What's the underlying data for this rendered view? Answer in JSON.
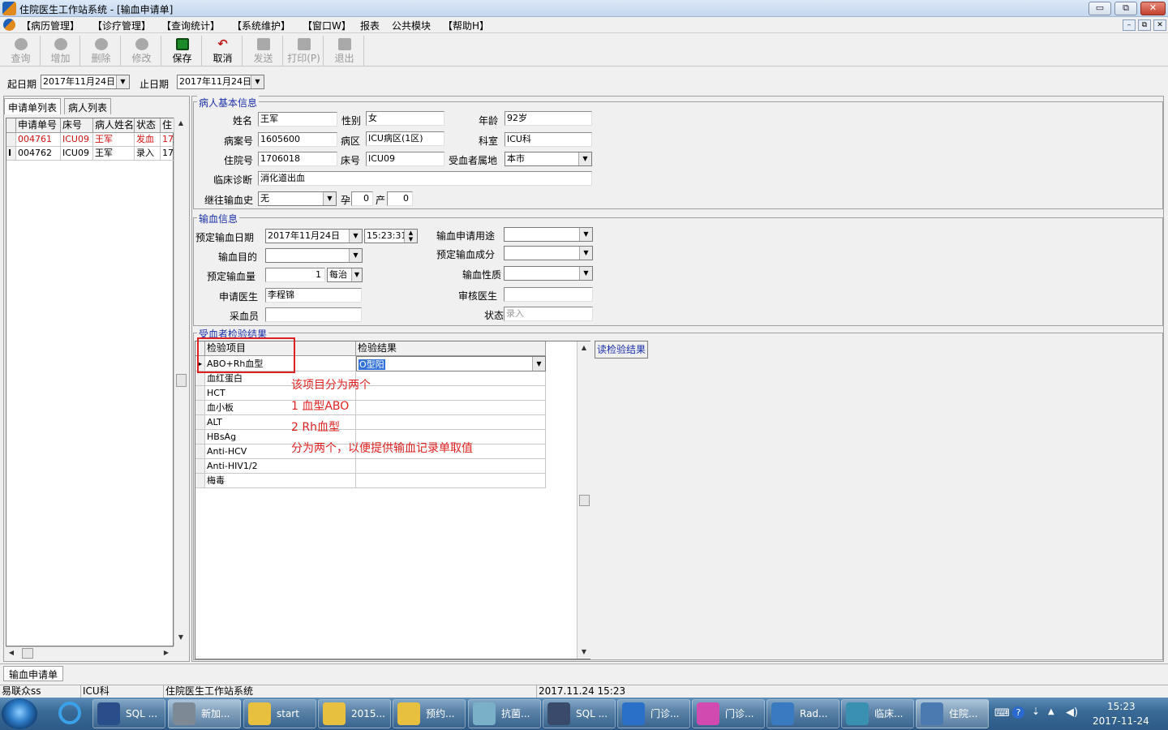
{
  "window": {
    "title": "住院医生工作站系统 - [输血申请单]",
    "min": "▭",
    "restore": "⧉",
    "close": "✕"
  },
  "menu": [
    "【病历管理】",
    "【诊疗管理】",
    "【查询统计】",
    "【系统维护】",
    "【窗口W】",
    "报表",
    "公共模块",
    "【帮助H】"
  ],
  "mdi": [
    "–",
    "⧉",
    "✕"
  ],
  "toolbar": [
    {
      "label": "查询",
      "enabled": false
    },
    {
      "label": "增加",
      "enabled": false
    },
    {
      "label": "删除",
      "enabled": false
    },
    {
      "label": "修改",
      "enabled": false
    },
    {
      "label": "保存",
      "enabled": true
    },
    {
      "label": "取消",
      "enabled": true
    },
    {
      "label": "发送",
      "enabled": false
    },
    {
      "label": "打印(P)",
      "enabled": false
    },
    {
      "label": "退出",
      "enabled": false
    }
  ],
  "datebar": {
    "start_label": "起日期",
    "start_value": "2017年11月24日",
    "end_label": "止日期",
    "end_value": "2017年11月24日"
  },
  "left": {
    "tabs": [
      "申请单列表",
      "病人列表"
    ],
    "columns": [
      "申请单号",
      "床号",
      "病人姓名",
      "状态",
      "住"
    ],
    "rows": [
      {
        "marker": "",
        "no": "004761",
        "bed": "ICU09",
        "name": "王军",
        "status": "发血",
        "z": "17"
      },
      {
        "marker": "I",
        "no": "004762",
        "bed": "ICU09",
        "name": "王军",
        "status": "录入",
        "z": "17"
      }
    ]
  },
  "patient": {
    "section": "病人基本信息",
    "name_label": "姓名",
    "name": "王军",
    "sex_label": "性别",
    "sex": "女",
    "age_label": "年龄",
    "age": "92岁",
    "case_label": "病案号",
    "case": "1605600",
    "ward_label": "病区",
    "ward": "ICU病区(1区)",
    "dept_label": "科室",
    "dept": "ICU科",
    "inpatient_label": "住院号",
    "inpatient": "1706018",
    "bed_label": "床号",
    "bed": "ICU09",
    "region_label": "受血者属地",
    "region": "本市",
    "diag_label": "临床诊断",
    "diag": "消化道出血",
    "history_label": "继往输血史",
    "history": "无",
    "preg_label": "孕",
    "preg": "0",
    "birth_label": "产",
    "birth": "0"
  },
  "transfusion": {
    "section": "输血信息",
    "date_label": "预定输血日期",
    "date": "2017年11月24日",
    "time": "15:23:31",
    "use_label": "输血申请用途",
    "use": "",
    "purpose_label": "输血目的",
    "purpose": "",
    "component_label": "预定输血成分",
    "component": "",
    "amount_label": "预定输血量",
    "amount": "1",
    "amount_unit": "每治",
    "nature_label": "输血性质",
    "nature": "",
    "doctor_label": "申请医生",
    "doctor": "李程锦",
    "reviewer_label": "审核医生",
    "reviewer": "",
    "collector_label": "采血员",
    "collector": "",
    "status_label": "状态",
    "status": "录入"
  },
  "tests": {
    "section": "受血者检验结果",
    "col_item": "检验项目",
    "col_result": "检验结果",
    "rows": [
      {
        "item": "ABO+Rh血型",
        "result": "O型阳"
      },
      {
        "item": "血红蛋白",
        "result": ""
      },
      {
        "item": "HCT",
        "result": ""
      },
      {
        "item": "血小板",
        "result": ""
      },
      {
        "item": "ALT",
        "result": ""
      },
      {
        "item": "HBsAg",
        "result": ""
      },
      {
        "item": "Anti-HCV",
        "result": ""
      },
      {
        "item": "Anti-HIV1/2",
        "result": ""
      },
      {
        "item": "梅毒",
        "result": ""
      }
    ],
    "read_button": "读检验结果"
  },
  "annotation": [
    "该项目分为两个",
    "1 血型ABO",
    "2 Rh血型",
    "分为两个，以便提供输血记录单取值"
  ],
  "bottom_tab": "输血申请单",
  "status": [
    "易联众ss",
    "ICU科",
    "住院医生工作站系统",
    "2017.11.24 15:23"
  ],
  "taskbar": {
    "items": [
      {
        "label": "",
        "color": "#1a5ca8"
      },
      {
        "label": "SQL ...",
        "color": "#2a4e8a"
      },
      {
        "label": "新加...",
        "color": "#7d8a96",
        "active": true
      },
      {
        "label": "start",
        "color": "#e8c040"
      },
      {
        "label": "2015...",
        "color": "#e8c040"
      },
      {
        "label": "预约...",
        "color": "#e8c040"
      },
      {
        "label": "抗菌...",
        "color": "#7ab0c8"
      },
      {
        "label": "SQL ...",
        "color": "#3a4a6a"
      },
      {
        "label": "门诊...",
        "color": "#2a70c8"
      },
      {
        "label": "门诊...",
        "color": "#d04ab0"
      },
      {
        "label": "Rad...",
        "color": "#3a7ac0"
      },
      {
        "label": "临床...",
        "color": "#3a90b0"
      },
      {
        "label": "住院...",
        "color": "#4a7ab0",
        "active": true
      }
    ],
    "time": "15:23",
    "date": "2017-11-24"
  }
}
